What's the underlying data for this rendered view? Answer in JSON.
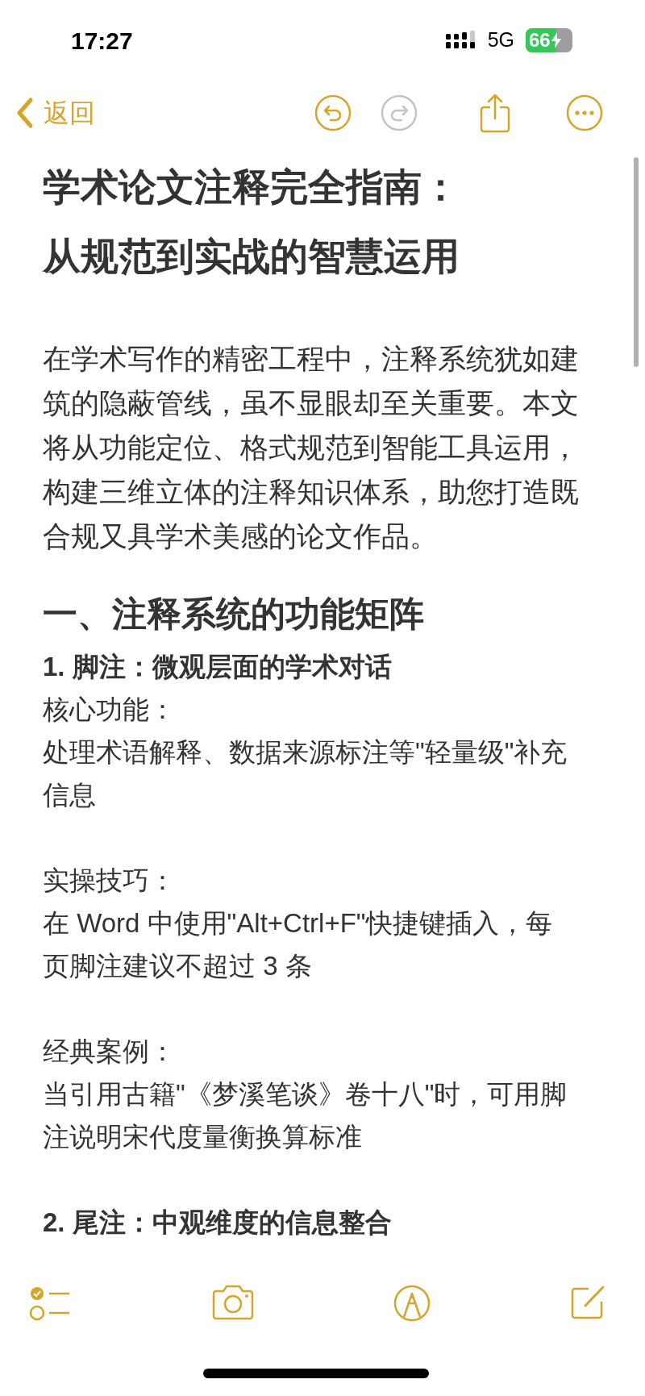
{
  "status_bar": {
    "time": "17:27",
    "network": "5G",
    "battery": "66"
  },
  "nav": {
    "back_label": "返回",
    "undo_enabled": true,
    "redo_enabled": false
  },
  "note": {
    "title_lines": [
      "学术论文注释完全指南：",
      "从规范到实战的智慧运用"
    ],
    "intro": "在学术写作的精密工程中，注释系统犹如建筑的隐蔽管线，虽不显眼却至关重要。本文将从功能定位、格式规范到智能工具运用，构建三维立体的注释知识体系，助您打造既合规又具学术美感的论文作品。",
    "sections": [
      {
        "heading": "一、注释系统的功能矩阵",
        "subsections": [
          {
            "title": "1. 脚注：微观层面的学术对话",
            "fields": [
              {
                "label": "核心功能：",
                "text": "处理术语解释、数据来源标注等\"轻量级\"补充信息"
              },
              {
                "label": "实操技巧：",
                "text": "在 Word 中使用\"Alt+Ctrl+F\"快捷键插入，每页脚注建议不超过 3 条"
              },
              {
                "label": "经典案例：",
                "text": "当引用古籍\"《梦溪笔谈》卷十八\"时，可用脚注说明宋代度量衡换算标准"
              }
            ]
          },
          {
            "title": "2. 尾注：中观维度的信息整合"
          }
        ]
      }
    ]
  }
}
